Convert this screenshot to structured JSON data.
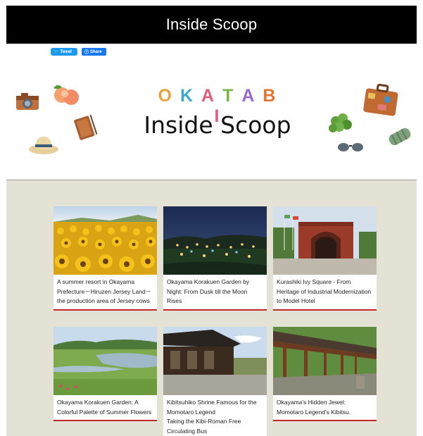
{
  "header": {
    "title": "Inside Scoop"
  },
  "share": {
    "tweet_label": "Tweet",
    "share_label": "Share"
  },
  "banner": {
    "brand_letters": [
      {
        "char": "O",
        "color": "#e8a33a"
      },
      {
        "char": "K",
        "color": "#3fa9c9"
      },
      {
        "char": "A",
        "color": "#e35c7e"
      },
      {
        "char": "T",
        "color": "#7cb848"
      },
      {
        "char": "A",
        "color": "#9b6ac7"
      },
      {
        "char": "B",
        "color": "#e8742f"
      },
      {
        "char": "I",
        "color": "#e35c7e"
      }
    ],
    "title": "Inside Scoop"
  },
  "articles": [
    {
      "caption": "A summer resort in Okayama Prefecture－Hiruzen Jersey Land－the production area of Jersey cows",
      "image": "sunflower-field"
    },
    {
      "caption": "Okayama Korakuen Garden by Night: From Dusk till the Moon Rises",
      "image": "night-garden"
    },
    {
      "caption": "Kurashiki Ivy Square - From Heritage of Industrial Modernization to Model Hotel",
      "image": "brick-gate"
    },
    {
      "caption": "Okayama Korakuen Garden: A Colorful Palette of Summer Flowers",
      "image": "garden-pond"
    },
    {
      "caption": "Kibitsuhiko Shrine Famous for the Momotaro Legend\nTaking the Kibi-Roman Free Circulating Bus",
      "image": "shrine"
    },
    {
      "caption": "Okayama's Hidden Jewel: Momotaro Legend's Kibitsu.",
      "image": "corridor"
    }
  ]
}
